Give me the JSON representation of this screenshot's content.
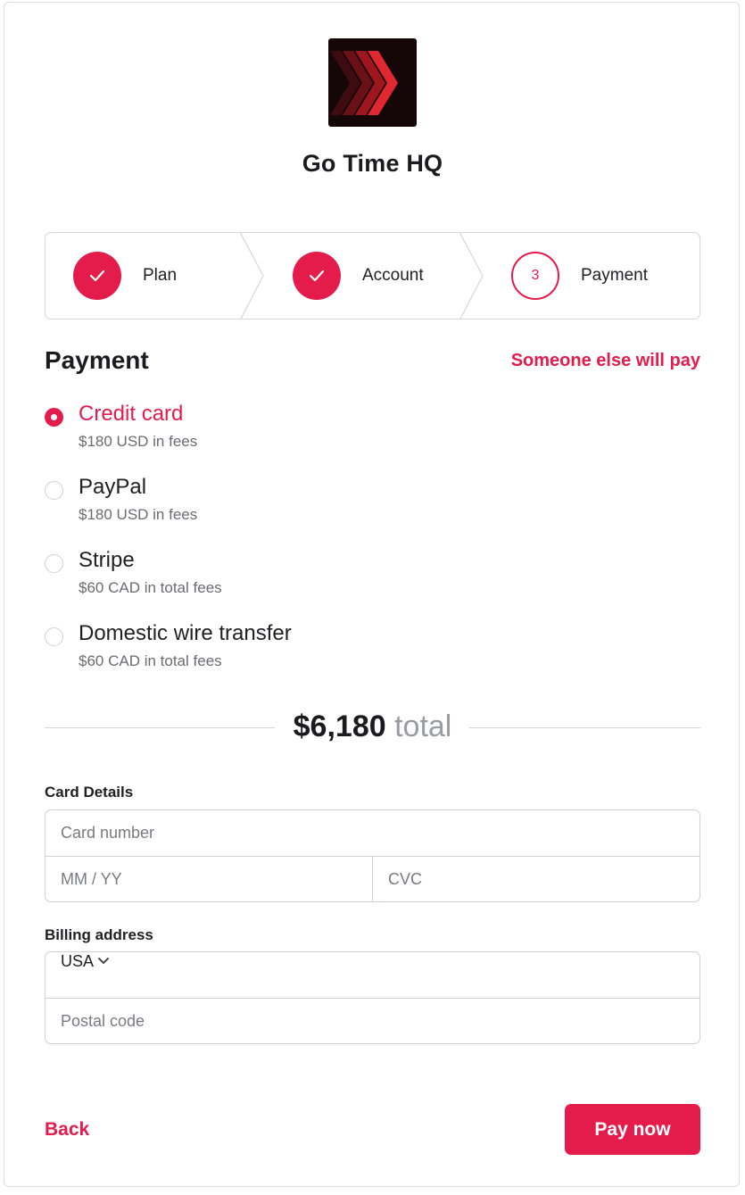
{
  "org": {
    "name": "Go Time HQ",
    "logo_icon": "chevrons-right-logo"
  },
  "steps": [
    {
      "label": "Plan",
      "state": "done"
    },
    {
      "label": "Account",
      "state": "done"
    },
    {
      "label": "Payment",
      "state": "current",
      "number": "3"
    }
  ],
  "payment": {
    "title": "Payment",
    "other_payer_link": "Someone else will pay",
    "options": [
      {
        "title": "Credit card",
        "fee": "$180 USD in fees",
        "selected": true
      },
      {
        "title": "PayPal",
        "fee": "$180 USD in fees",
        "selected": false
      },
      {
        "title": "Stripe",
        "fee": "$60 CAD in total fees",
        "selected": false
      },
      {
        "title": "Domestic wire transfer",
        "fee": "$60 CAD in total fees",
        "selected": false
      }
    ]
  },
  "total": {
    "amount": "$6,180",
    "suffix": "total"
  },
  "card": {
    "label": "Card Details",
    "number_placeholder": "Card number",
    "expiry_placeholder": "MM / YY",
    "cvc_placeholder": "CVC"
  },
  "billing": {
    "label": "Billing address",
    "country": "USA",
    "postal_placeholder": "Postal code"
  },
  "footer": {
    "back_label": "Back",
    "pay_label": "Pay now"
  },
  "colors": {
    "accent": "#e31c4b",
    "border": "#d0d0d6",
    "muted": "#6b6b73"
  }
}
